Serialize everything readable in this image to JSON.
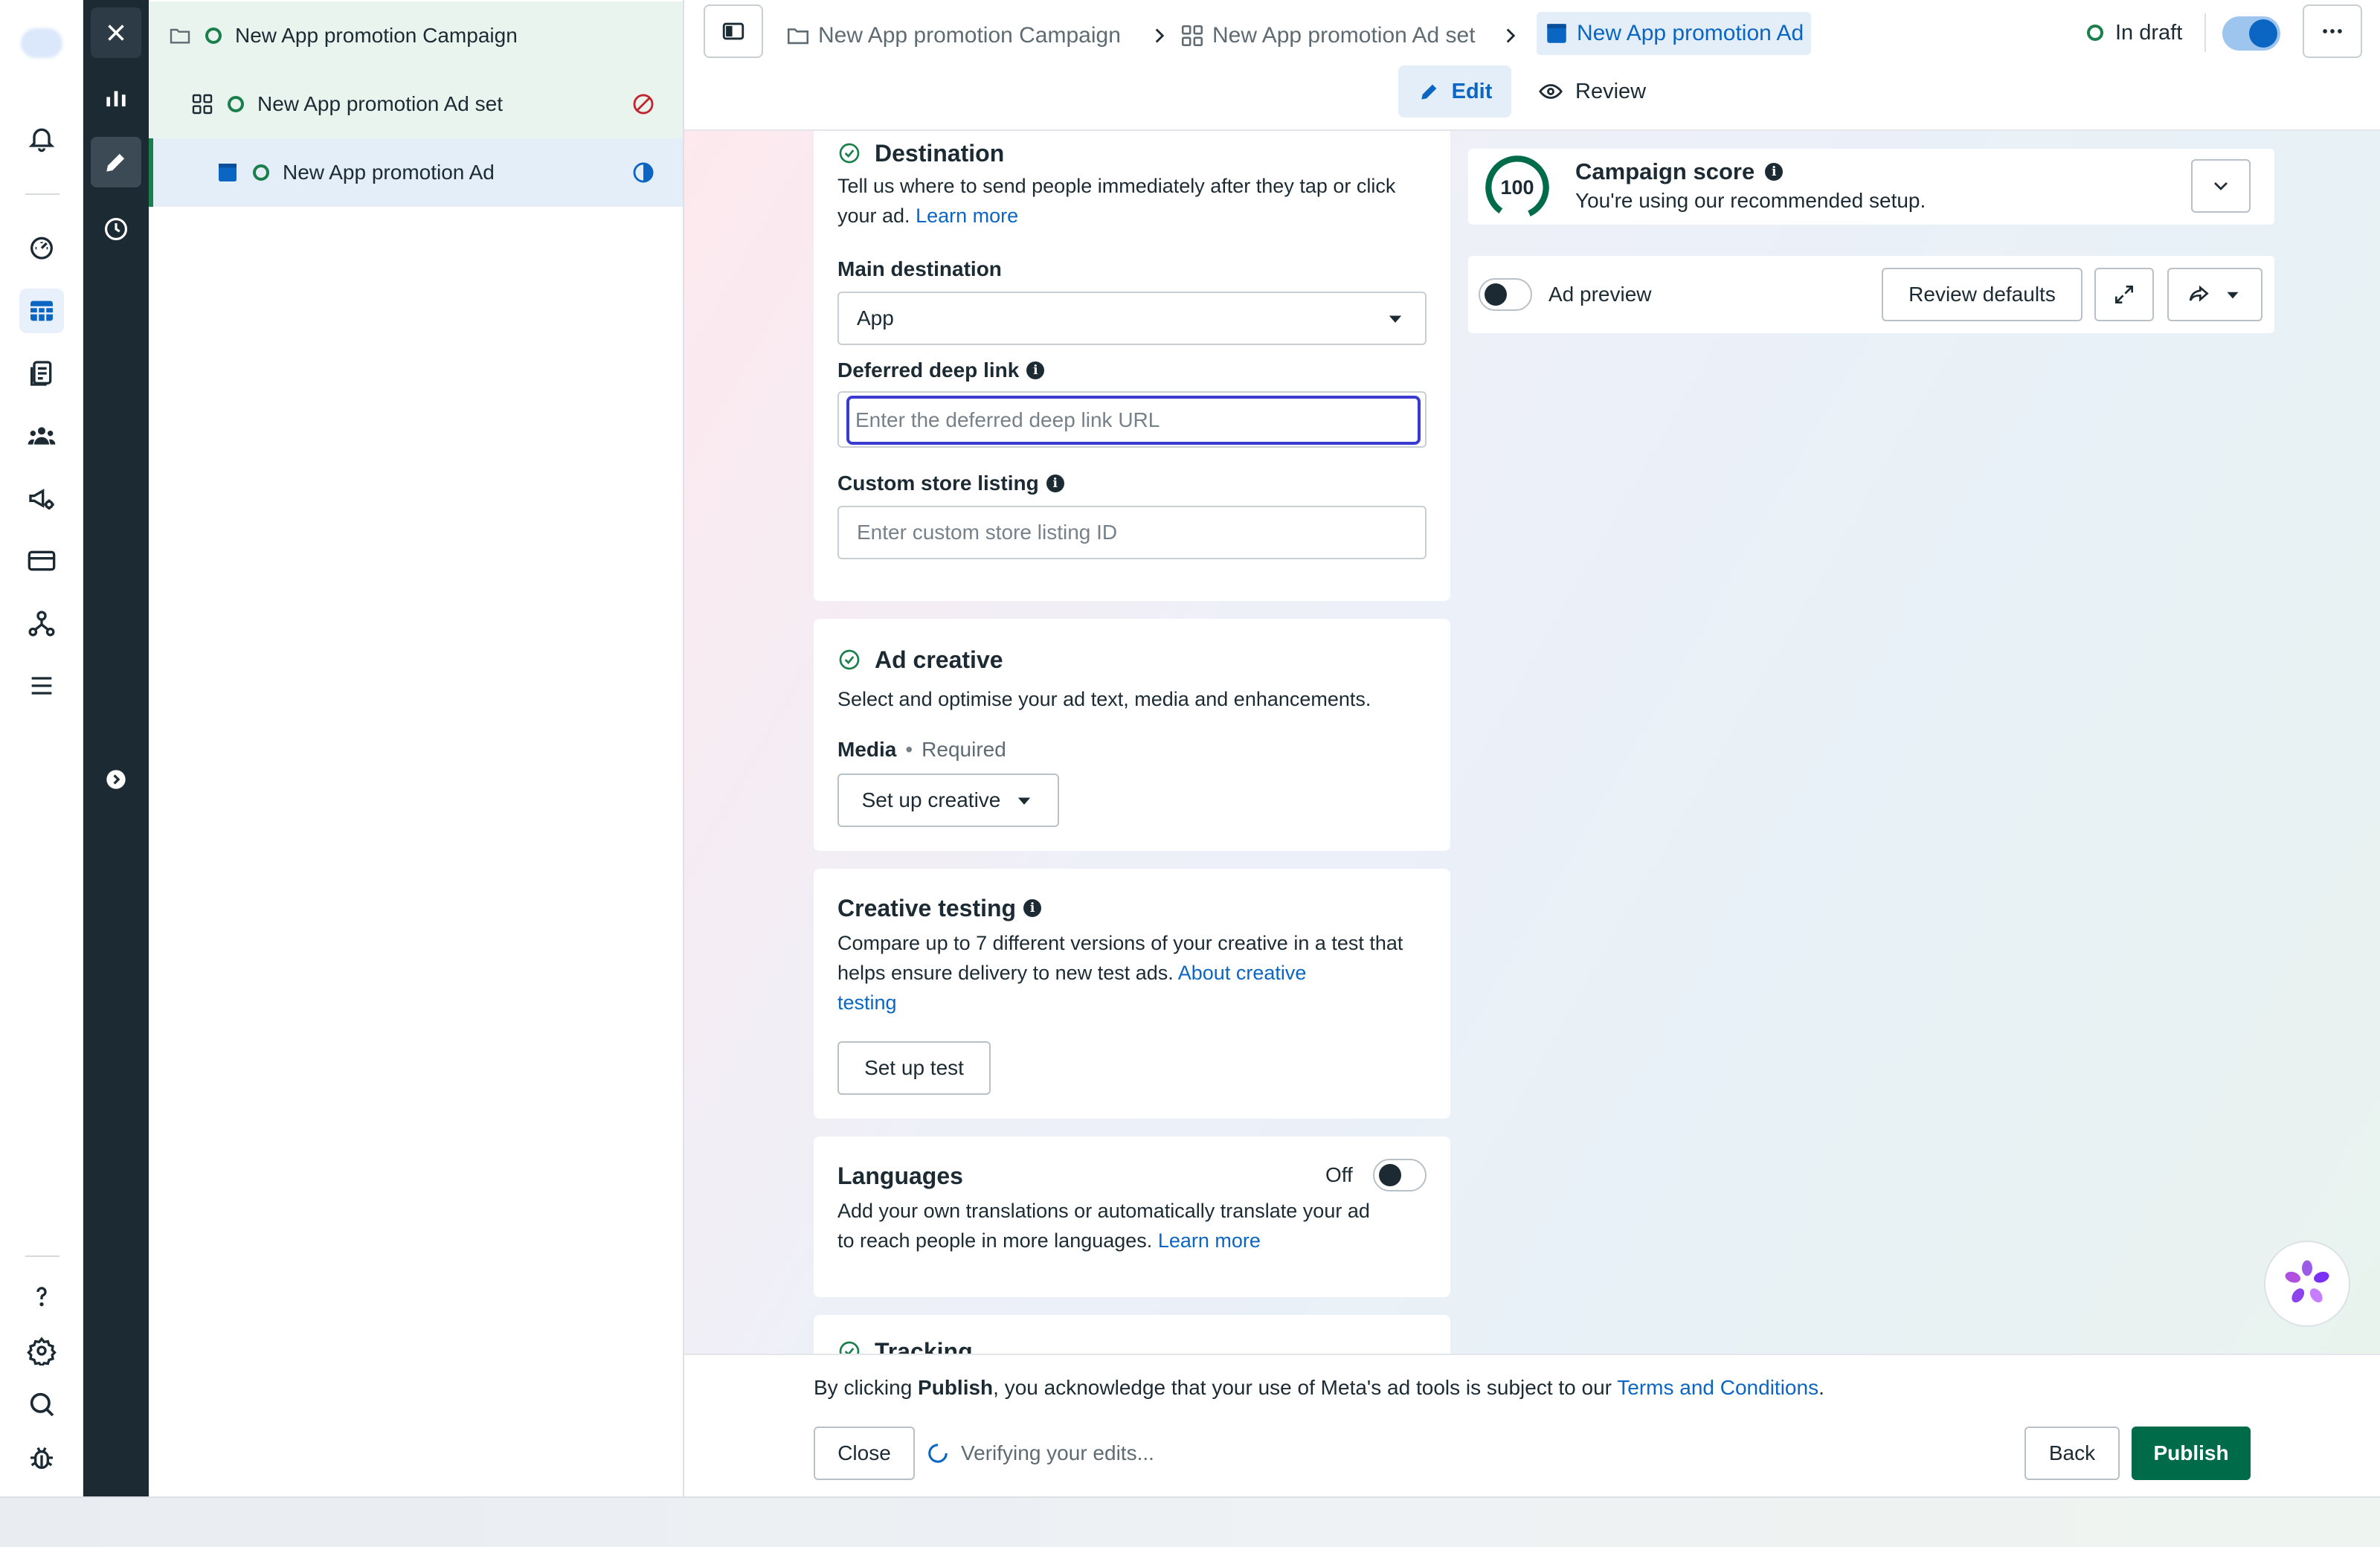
{
  "rail": {
    "icons": [
      "meta-logo-icon",
      "bell-icon",
      "dashboard-icon",
      "campaigns-table-icon",
      "reports-icon",
      "audiences-icon",
      "ads-manager-icon",
      "billing-icon",
      "events-manager-icon",
      "menu-icon",
      "help-icon",
      "settings-icon",
      "search-icon",
      "bug-icon"
    ]
  },
  "tree": {
    "campaign": {
      "label": "New App promotion Campaign"
    },
    "adset": {
      "label": "New App promotion Ad set",
      "status_icon": "prohibited-icon"
    },
    "ad": {
      "label": "New App promotion Ad",
      "status_icon": "half-circle-icon"
    }
  },
  "topbar": {
    "breadcrumb": {
      "campaign": "New App promotion Campaign",
      "adset": "New App promotion Ad set",
      "ad": "New App promotion Ad"
    },
    "status": "In draft",
    "tabs": {
      "edit": "Edit",
      "review": "Review"
    }
  },
  "destination": {
    "title": "Destination",
    "description": "Tell us where to send people immediately after they tap or click your ad.",
    "learn_more": "Learn more",
    "main_destination_label": "Main destination",
    "main_destination_value": "App",
    "deferred_label": "Deferred deep link",
    "deferred_placeholder": "Enter the deferred deep link URL",
    "custom_store_label": "Custom store listing",
    "custom_store_placeholder": "Enter custom store listing ID"
  },
  "ad_creative": {
    "title": "Ad creative",
    "description": "Select and optimise your ad text, media and enhancements.",
    "media_label": "Media",
    "required": "Required",
    "setup_button": "Set up creative"
  },
  "creative_testing": {
    "title": "Creative testing",
    "description": "Compare up to 7 different versions of your creative in a test that helps ensure delivery to new test ads.",
    "link_line1": "About creative",
    "link_line2": "testing",
    "button": "Set up test"
  },
  "languages": {
    "title": "Languages",
    "toggle_label": "Off",
    "description_line1": "Add your own translations or automatically translate your ad",
    "description_line2": "to reach people in more languages.",
    "learn_more": "Learn more"
  },
  "tracking": {
    "title": "Tracking"
  },
  "campaign_score": {
    "score": "100",
    "title": "Campaign score",
    "subtitle": "You're using our recommended setup."
  },
  "preview": {
    "label": "Ad preview",
    "review_defaults": "Review defaults"
  },
  "footer": {
    "text_prefix": "By clicking ",
    "text_bold": "Publish",
    "text_mid": ", you acknowledge that your use of Meta's ad tools is subject to our ",
    "terms_link": "Terms and Conditions",
    "text_end": ".",
    "close": "Close",
    "verifying": "Verifying your edits...",
    "back": "Back",
    "publish": "Publish"
  },
  "colors": {
    "accent_blue": "#0a66c2",
    "publish_green": "#006b48",
    "status_green": "#1a7f4b",
    "dark_column": "#1c2b33",
    "focus_border": "#3a3ad0"
  }
}
